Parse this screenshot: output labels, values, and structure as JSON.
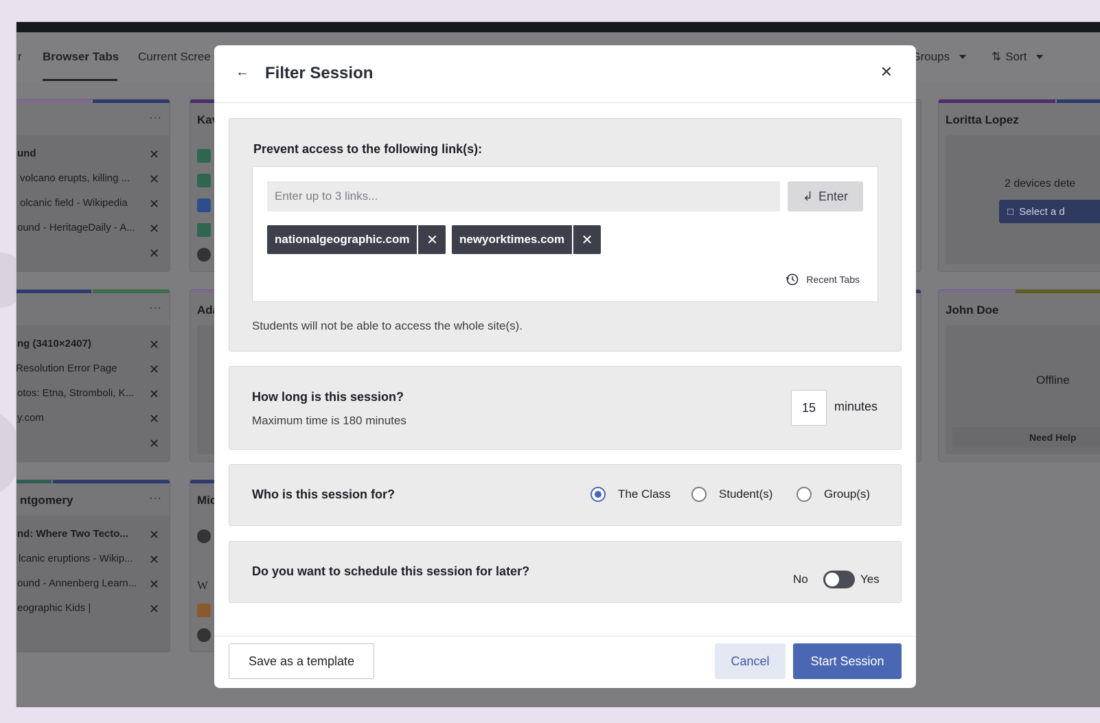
{
  "header": {
    "tab_partial": "r",
    "tab_active": "Browser Tabs",
    "tab_current": "Current Scree",
    "groups_label": "Groups",
    "sort_label": "Sort"
  },
  "background_cards": {
    "card1": {
      "rows": [
        "und",
        "volcano erupts, killing ...",
        "olcanic field - Wikipedia",
        "ound - HeritageDaily - A...",
        ""
      ]
    },
    "card2": {
      "title": "Kav"
    },
    "card3": {
      "rows": [
        "ng (3410×2407)",
        "Resolution Error Page",
        "otos: Etna, Stromboli, K...",
        "y.com",
        ""
      ]
    },
    "card4": {
      "title": "Ada"
    },
    "card5": {
      "title": "ntgomery",
      "rows": [
        "nd: Where Two Tecto...",
        "lcanic eruptions - Wikip...",
        "ound - Annenberg Learn...",
        "eographic Kids |"
      ]
    },
    "card6": {
      "title": "Mic"
    },
    "loritta": {
      "title": "Loritta Lopez",
      "status": "2 devices dete",
      "select_label": "Select a d"
    },
    "john": {
      "title": "John Doe",
      "status": "Offline",
      "help_label": "Need Help"
    },
    "dots": "···"
  },
  "modal": {
    "title": "Filter Session",
    "links_section": {
      "heading": "Prevent access to the following link(s):",
      "input_placeholder": "Enter up to 3 links...",
      "enter_label": "Enter",
      "chips": [
        "nationalgeographic.com",
        "newyorktimes.com"
      ],
      "recent_tabs_label": "Recent Tabs",
      "note": "Students will not be able to access the whole site(s)."
    },
    "duration_section": {
      "heading": "How long is this session?",
      "sub": "Maximum time is 180 minutes",
      "value": "15",
      "unit": "minutes"
    },
    "audience_section": {
      "heading": "Who is this session for?",
      "options": [
        "The Class",
        "Student(s)",
        "Group(s)"
      ],
      "selected": "The Class"
    },
    "schedule_section": {
      "heading": "Do you want to schedule this session for later?",
      "no_label": "No",
      "yes_label": "Yes",
      "enabled": false
    },
    "footer": {
      "template_label": "Save as a template",
      "cancel_label": "Cancel",
      "start_label": "Start Session"
    }
  },
  "colors": {
    "accent": "#4a67b3",
    "chip": "#3d404a",
    "overlay": "#7d7d80"
  }
}
